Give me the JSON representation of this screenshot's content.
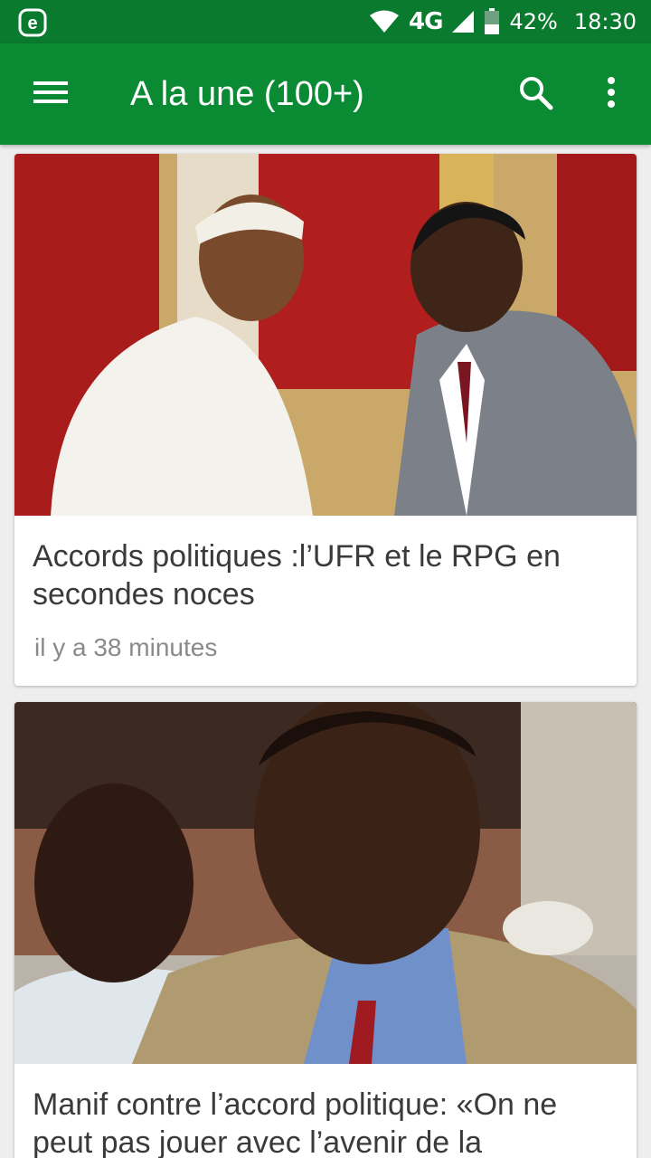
{
  "status_bar": {
    "network": "4G",
    "battery": "42%",
    "time": "18:30",
    "icons": [
      "app-e-icon",
      "wifi-icon",
      "signal-icon",
      "battery-icon"
    ]
  },
  "app_bar": {
    "title": "A la une (100+)",
    "icons": [
      "menu-icon",
      "search-icon",
      "more-vert-icon"
    ],
    "color": "#0b8a34"
  },
  "articles": [
    {
      "headline": "Accords politiques :l’UFR et le RPG en secondes noces",
      "time": "il y a 38 minutes"
    },
    {
      "headline": "Manif contre l’accord politique: «On ne peut pas jouer avec l’avenir de la",
      "time": ""
    }
  ]
}
